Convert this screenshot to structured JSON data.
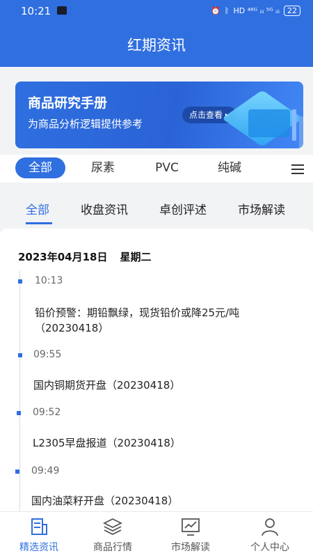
{
  "status_bar": {
    "time": "10:21",
    "signal": "HD ⁴⁶ᴳ ᵢᵢᵢ ⁵ᴳ ᵢᵢᵢ",
    "battery": "22"
  },
  "app": {
    "title": "红期资讯"
  },
  "banner": {
    "title": "商品研究手册",
    "subtitle": "为商品分析逻辑提供参考",
    "button": "点击查看 ▸"
  },
  "category_tabs": [
    {
      "label": "全部",
      "active": true
    },
    {
      "label": "尿素",
      "active": false
    },
    {
      "label": "PVC",
      "active": false
    },
    {
      "label": "纯碱",
      "active": false
    }
  ],
  "sub_tabs": [
    {
      "label": "全部",
      "active": true
    },
    {
      "label": "收盘资讯",
      "active": false
    },
    {
      "label": "卓创评述",
      "active": false
    },
    {
      "label": "市场解读",
      "active": false
    }
  ],
  "feed": {
    "date": "2023年04月18日",
    "weekday": "星期二",
    "items": [
      {
        "time": "10:13",
        "text": "铅价预警：期铅飘绿，现货铅价或降25元/吨（20230418）"
      },
      {
        "time": "09:55",
        "text": "国内铜期货开盘（20230418）"
      },
      {
        "time": "09:52",
        "text": "L2305早盘报道（20230418）"
      },
      {
        "time": "09:49",
        "text": "国内油菜籽开盘（20230418）"
      }
    ]
  },
  "bottom_nav": [
    {
      "label": "精选资讯",
      "icon": "news-icon",
      "active": true
    },
    {
      "label": "商品行情",
      "icon": "layers-icon",
      "active": false
    },
    {
      "label": "市场解读",
      "icon": "chart-icon",
      "active": false
    },
    {
      "label": "个人中心",
      "icon": "user-icon",
      "active": false
    }
  ],
  "colors": {
    "accent": "#2f6fe0"
  }
}
